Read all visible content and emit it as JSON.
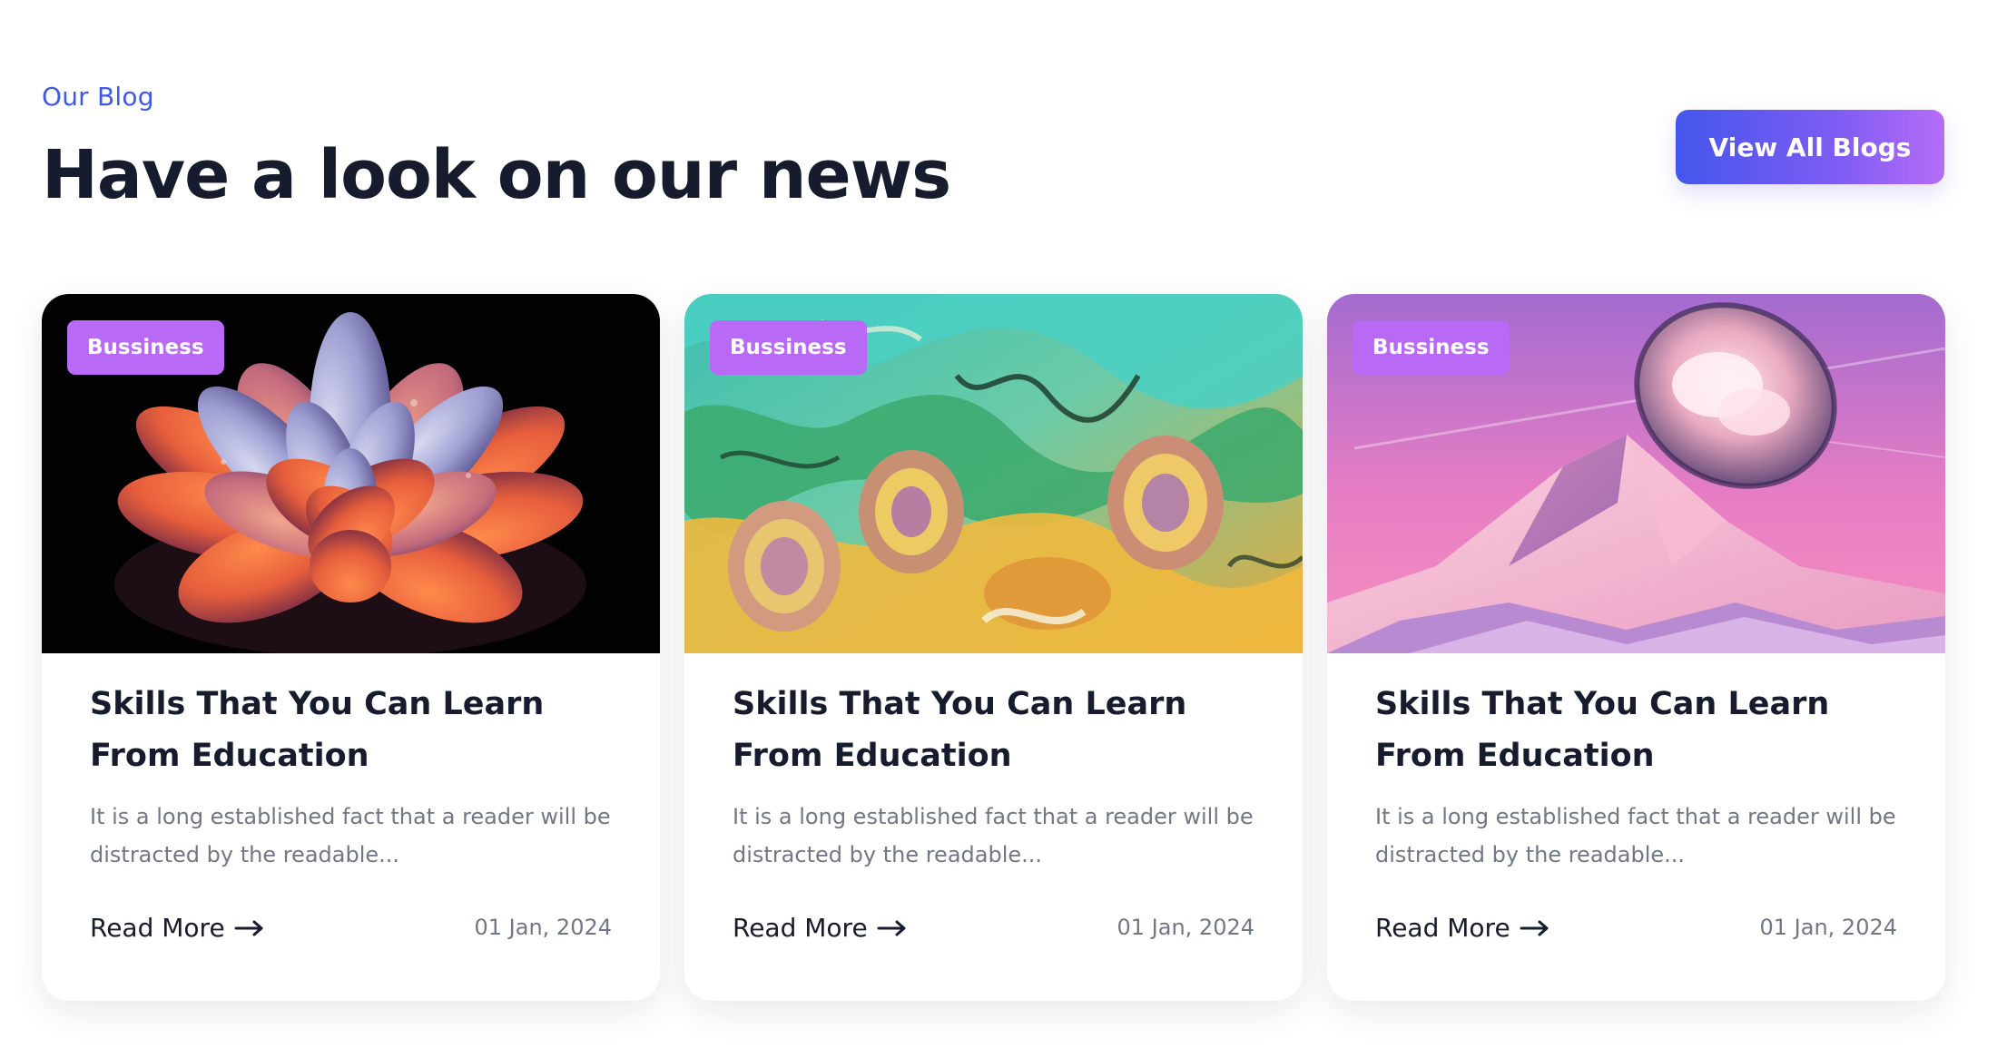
{
  "header": {
    "eyebrow": "Our Blog",
    "title": "Have a look on our news",
    "view_all_label": "View All Blogs"
  },
  "colors": {
    "accent_blue": "#3d5ae8",
    "button_gradient_start": "#4456ec",
    "button_gradient_end": "#b66cf8",
    "tag_purple": "#b86af6",
    "heading": "#161c2d",
    "muted_text": "#707785"
  },
  "cards": [
    {
      "tag": "Bussiness",
      "title": "Skills That You Can Learn From Education",
      "excerpt": "It is a long established fact that a reader will be distracted by the readable...",
      "read_more": "Read More",
      "arrow_icon": "arrow-right-icon",
      "date": "01 Jan, 2024",
      "image": "succulent-flower-image"
    },
    {
      "tag": "Bussiness",
      "title": "Skills That You Can Learn From Education",
      "excerpt": "It is a long established fact that a reader will be distracted by the readable...",
      "read_more": "Read More",
      "arrow_icon": "arrow-right-icon",
      "date": "01 Jan, 2024",
      "image": "marbled-paint-image"
    },
    {
      "tag": "Bussiness",
      "title": "Skills That You Can Learn From Education",
      "excerpt": "It is a long established fact that a reader will be distracted by the readable...",
      "read_more": "Read More",
      "arrow_icon": "arrow-right-icon",
      "date": "01 Jan, 2024",
      "image": "pink-mountain-image"
    }
  ]
}
